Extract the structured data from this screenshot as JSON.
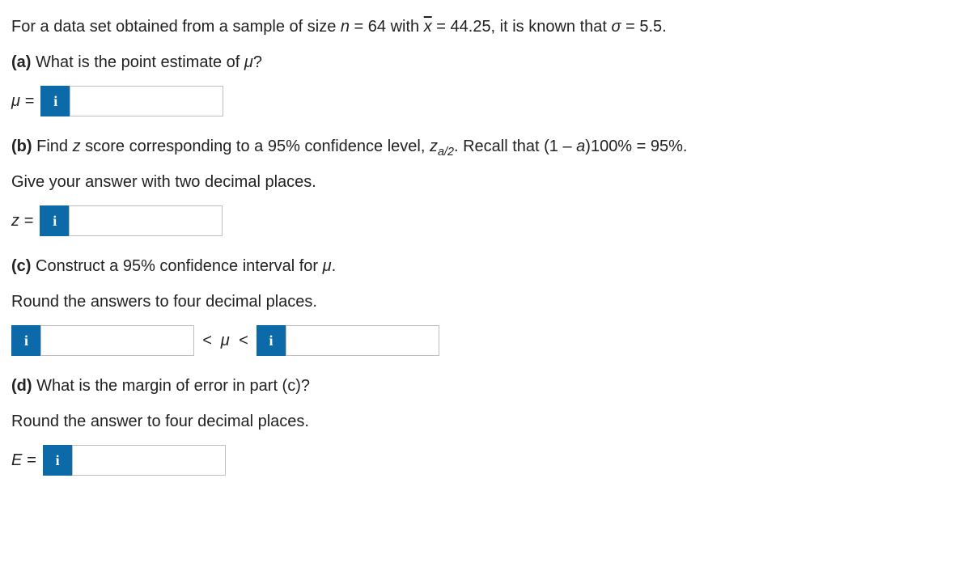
{
  "intro": "For a data set obtained from a sample of size ",
  "intro2": " = 64 with ",
  "intro3": " = 44.25, it is known that ",
  "intro4": " = 5.5.",
  "n_var": "n",
  "xbar_var": "x",
  "sigma_var": "σ",
  "partA": {
    "label": "(a)",
    "text": " What is the point estimate of ",
    "var": "μ",
    "q": "?",
    "prefix": "μ ="
  },
  "partB": {
    "label": "(b)",
    "text": " Find ",
    "zword": "z",
    "text2": " score corresponding to a 95% confidence level, ",
    "zsub_base": "z",
    "zsub_sub": "a/2",
    "text3": ". Recall that (1 – ",
    "alpha": "a",
    "text4": ")100% = 95%.",
    "line2": "Give your answer with two decimal places.",
    "prefix": "z ="
  },
  "partC": {
    "label": "(c)",
    "text": " Construct a 95% confidence interval for ",
    "var": "μ",
    "dot": ".",
    "line2": "Round the answers to four decimal places.",
    "between": "<  μ  <"
  },
  "partD": {
    "label": "(d)",
    "text": " What is the margin of error in part (c)?",
    "line2": "Round the answer to four decimal places.",
    "prefix": "E ="
  },
  "info_icon": "i"
}
